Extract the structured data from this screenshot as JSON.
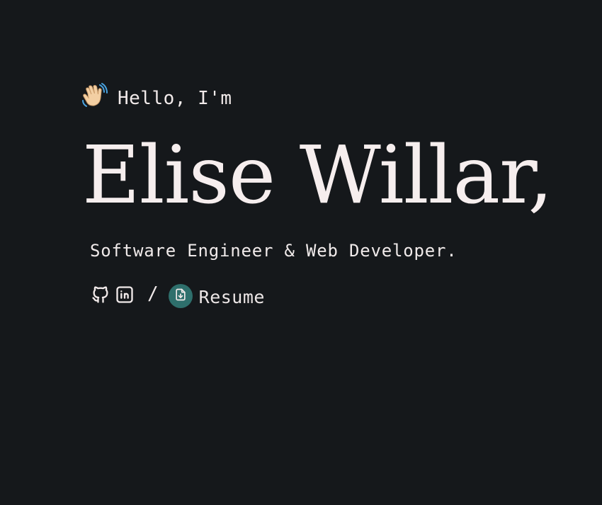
{
  "hero": {
    "greeting": "Hello, I'm",
    "name": "Elise Willar,",
    "role": "Software Engineer & Web Developer.",
    "separator": "/",
    "resume_label": "Resume"
  },
  "icons": {
    "wave": "waving-hand-icon",
    "github": "github-icon",
    "linkedin": "linkedin-icon",
    "resume": "file-download-icon"
  },
  "colors": {
    "background": "#15181b",
    "text": "#f4eeee",
    "resume_badge": "#2e6f6c"
  }
}
